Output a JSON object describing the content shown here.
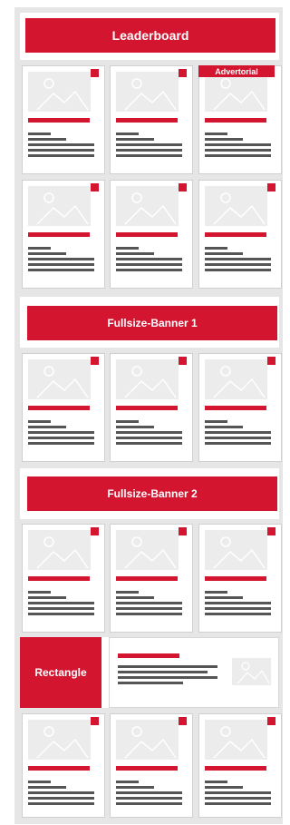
{
  "leaderboard": {
    "label": "Leaderboard"
  },
  "banners": [
    {
      "label": "Fullsize-Banner 1"
    },
    {
      "label": "Fullsize-Banner 2"
    }
  ],
  "advertorial": {
    "label": "Advertorial"
  },
  "rectangle": {
    "label": "Rectangle"
  },
  "colors": {
    "accent": "#d31530",
    "frame": "#e6e6e6",
    "text_line": "#555555",
    "placeholder": "#ececec"
  },
  "icons": {
    "card_image": "image-placeholder-icon",
    "card_corner": "corner-marker-icon"
  }
}
